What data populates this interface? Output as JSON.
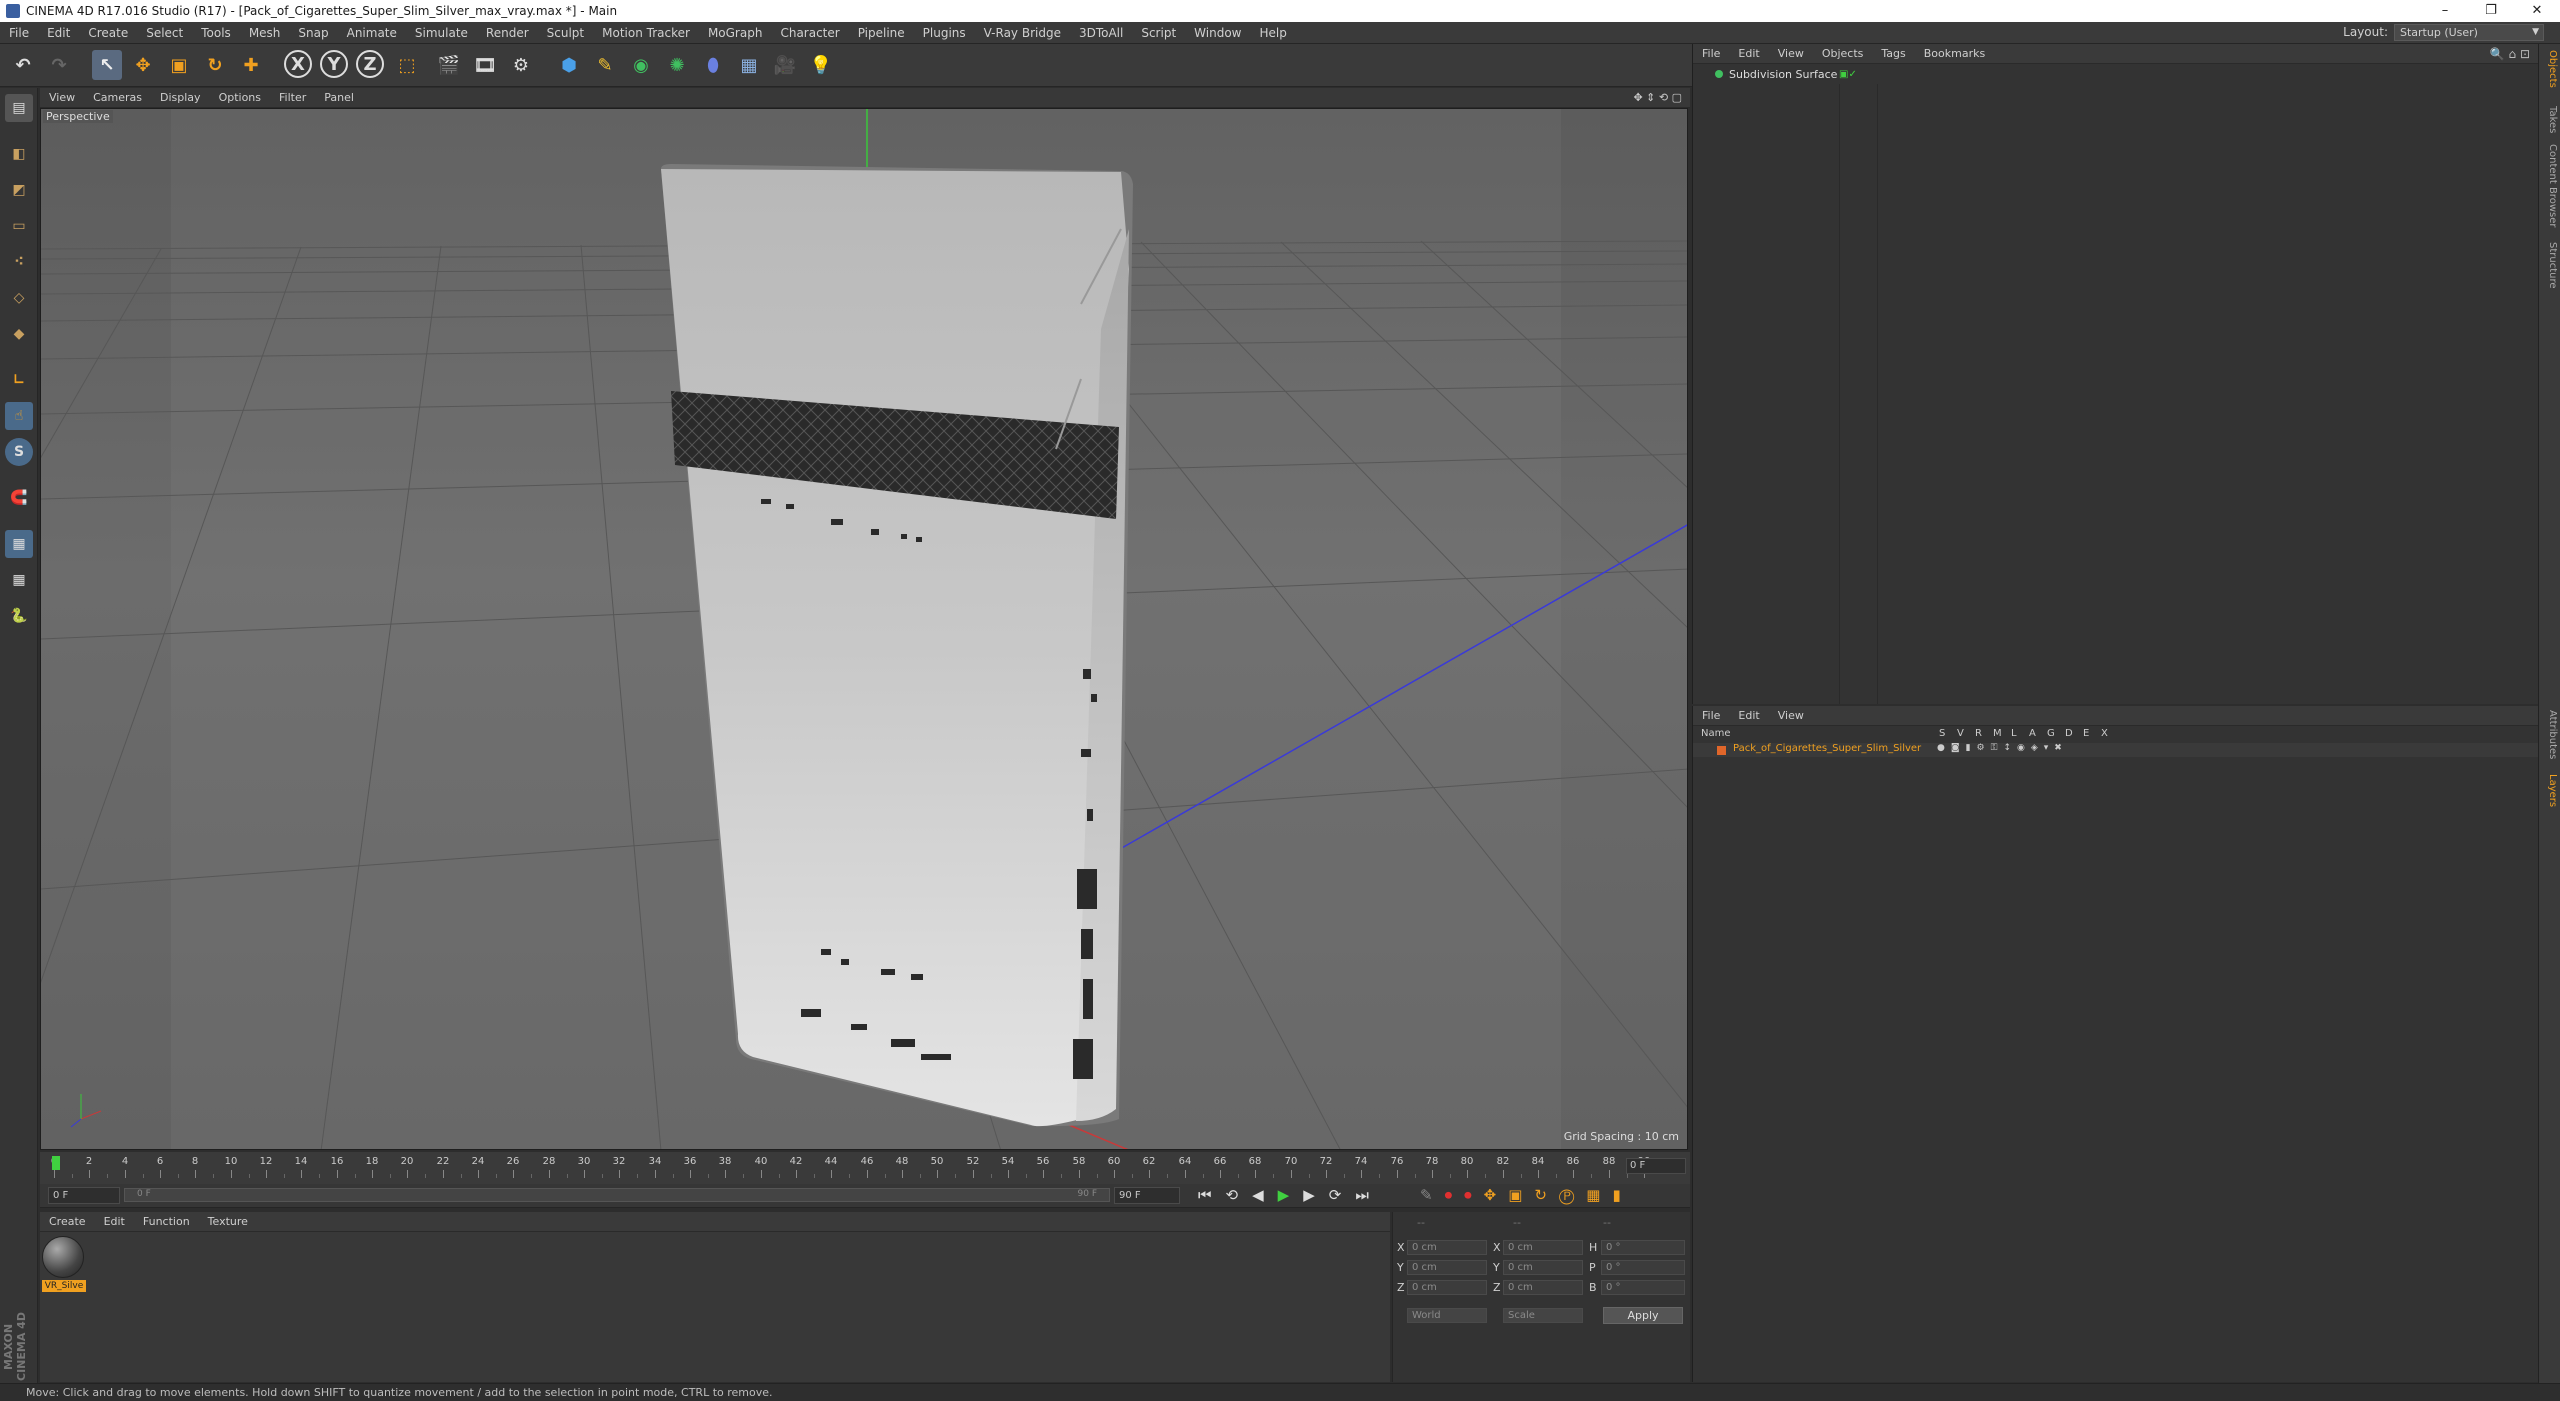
{
  "window": {
    "title": "CINEMA 4D R17.016 Studio (R17) - [Pack_of_Cigarettes_Super_Slim_Silver_max_vray.max *] - Main",
    "minimize": "–",
    "maximize": "❐",
    "close": "✕"
  },
  "menubar": {
    "items": [
      "File",
      "Edit",
      "Create",
      "Select",
      "Tools",
      "Mesh",
      "Snap",
      "Animate",
      "Simulate",
      "Render",
      "Sculpt",
      "Motion Tracker",
      "MoGraph",
      "Character",
      "Pipeline",
      "Plugins",
      "V-Ray Bridge",
      "3DToAll",
      "Script",
      "Window",
      "Help"
    ],
    "layout_label": "Layout:",
    "layout_value": "Startup (User)"
  },
  "toolbar": {
    "axis_x": "X",
    "axis_y": "Y",
    "axis_z": "Z"
  },
  "left_tools": {
    "snap_label": "S"
  },
  "viewport": {
    "menu": [
      "View",
      "Cameras",
      "Display",
      "Options",
      "Filter",
      "Panel"
    ],
    "label": "Perspective",
    "grid_spacing": "Grid Spacing : 10 cm",
    "colors": {
      "background": "#6a6a6a",
      "grid": "#5a5a5a",
      "y_axis": "#3ac83a",
      "z_axis": "#3a3ad8",
      "x_axis": "#c83a3a"
    }
  },
  "timeline": {
    "ticks": [
      "0",
      "2",
      "4",
      "6",
      "8",
      "10",
      "12",
      "14",
      "16",
      "18",
      "20",
      "22",
      "24",
      "26",
      "28",
      "30",
      "32",
      "34",
      "36",
      "38",
      "40",
      "42",
      "44",
      "46",
      "48",
      "50",
      "52",
      "54",
      "56",
      "58",
      "60",
      "62",
      "64",
      "66",
      "68",
      "70",
      "72",
      "74",
      "76",
      "78",
      "80",
      "82",
      "84",
      "86",
      "88",
      "90"
    ],
    "current_frame": "0 F",
    "start_field": "0 F",
    "range_start": "0 F",
    "range_end": "90 F",
    "end_field": "90 F"
  },
  "materials": {
    "menu": [
      "Create",
      "Edit",
      "Function",
      "Texture"
    ],
    "items": [
      {
        "label": "VR_Silve"
      }
    ]
  },
  "coords": {
    "header": [
      "--",
      "--",
      "--"
    ],
    "rows": [
      {
        "a": "X",
        "a_val": "0 cm",
        "b": "X",
        "b_val": "0 cm",
        "c": "H",
        "c_val": "0 °"
      },
      {
        "a": "Y",
        "a_val": "0 cm",
        "b": "Y",
        "b_val": "0 cm",
        "c": "P",
        "c_val": "0 °"
      },
      {
        "a": "Z",
        "a_val": "0 cm",
        "b": "Z",
        "b_val": "0 cm",
        "c": "B",
        "c_val": "0 °"
      }
    ],
    "mode": "World",
    "scale_mode": "Scale",
    "apply": "Apply"
  },
  "object_manager": {
    "menu": [
      "File",
      "Edit",
      "View",
      "Objects",
      "Tags",
      "Bookmarks"
    ],
    "objects": [
      {
        "name": "Subdivision Surface"
      }
    ]
  },
  "layer_manager": {
    "menu": [
      "File",
      "Edit",
      "View"
    ],
    "columns": {
      "name": "Name",
      "flags": [
        "S",
        "V",
        "R",
        "M",
        "L",
        "A",
        "G",
        "D",
        "E",
        "X"
      ]
    },
    "layers": [
      {
        "name": "Pack_of_Cigarettes_Super_Slim_Silver",
        "color": "#e0662a"
      }
    ]
  },
  "right_tabs": [
    "Objects",
    "Takes",
    "Content Browser",
    "Structure",
    "Attributes",
    "Layers"
  ],
  "brand": "MAXON CINEMA 4D",
  "status": "Move: Click and drag to move elements. Hold down SHIFT to quantize movement / add to the selection in point mode, CTRL to remove."
}
